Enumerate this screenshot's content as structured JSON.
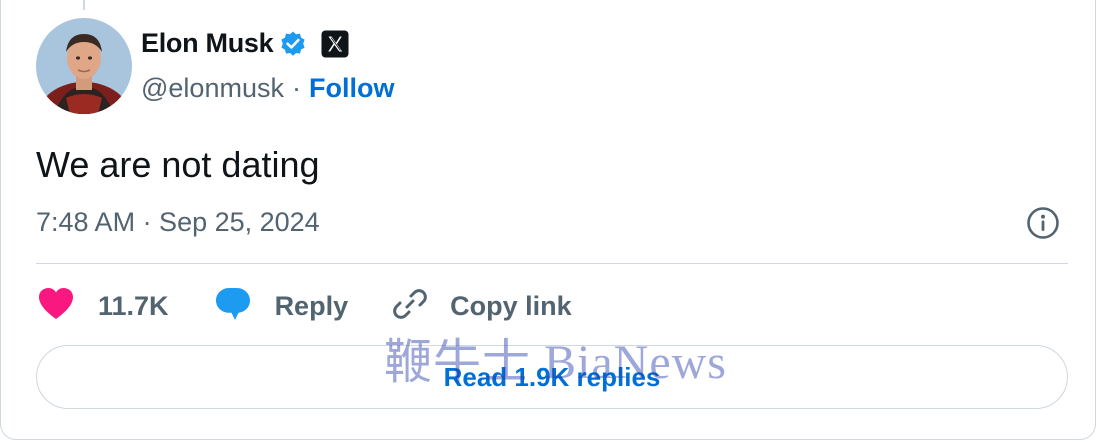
{
  "tweet": {
    "author_name": "Elon Musk",
    "handle": "@elonmusk",
    "separator": "·",
    "follow_label": "Follow",
    "text": "We are not dating",
    "timestamp": "7:48 AM · Sep 25, 2024"
  },
  "actions": {
    "like_count": "11.7K",
    "reply_label": "Reply",
    "copy_link_label": "Copy link"
  },
  "read_replies_label": "Read 1.9K replies",
  "watermark": "鞭牛士 BiaNews",
  "icons": {
    "verified": "verified-badge-icon",
    "x_logo": "x-logo-icon",
    "info": "info-icon",
    "heart": "heart-icon",
    "reply": "reply-bubble-icon",
    "link": "link-icon"
  },
  "colors": {
    "accent": "#006fd6",
    "heart": "#f91880",
    "verified": "#1d9bf0",
    "muted_text": "#536471",
    "border": "#cfd9de"
  }
}
